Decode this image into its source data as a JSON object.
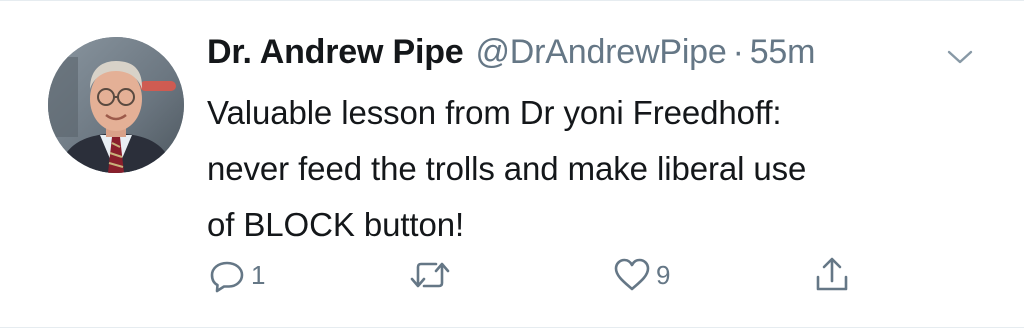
{
  "tweet": {
    "author": {
      "display_name": "Dr. Andrew Pipe",
      "handle": "@DrAndrewPipe",
      "separator": "·",
      "time": "55m"
    },
    "text_lines": [
      "Valuable lesson from Dr yoni Freedhoff:",
      "never feed the trolls and make liberal use",
      "of BLOCK button!"
    ],
    "actions": {
      "reply": {
        "icon": "reply-icon",
        "count": "1"
      },
      "retweet": {
        "icon": "retweet-icon",
        "count": ""
      },
      "like": {
        "icon": "heart-icon",
        "count": "9"
      },
      "share": {
        "icon": "share-icon",
        "count": ""
      }
    }
  },
  "colors": {
    "name": "#14171a",
    "secondary": "#657786",
    "border": "#e6ecf0"
  }
}
